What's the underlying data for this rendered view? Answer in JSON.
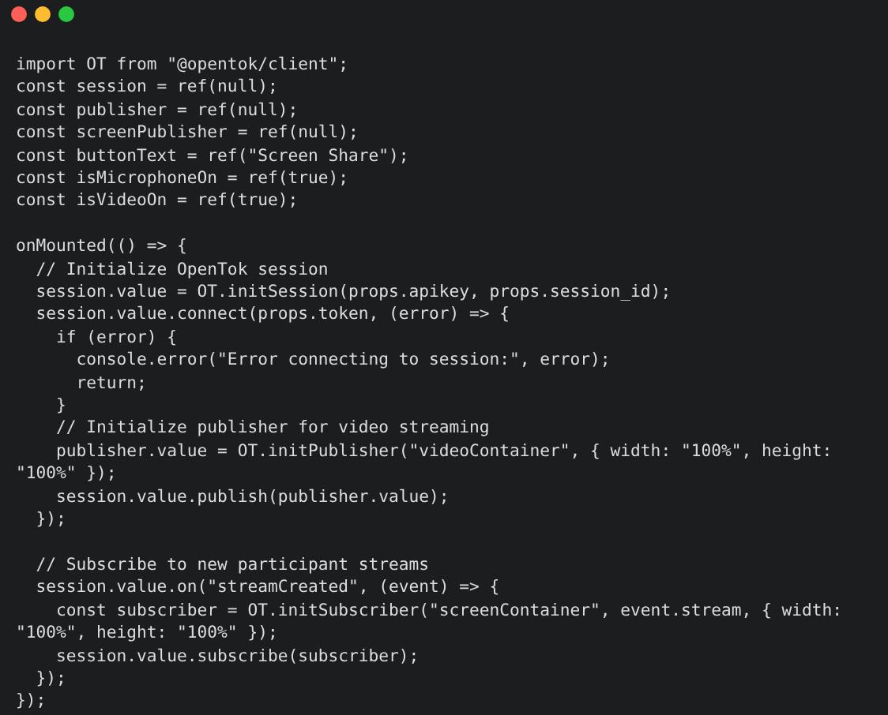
{
  "window_controls": [
    {
      "color": "#ff5f57"
    },
    {
      "color": "#febc2e"
    },
    {
      "color": "#28c840"
    }
  ],
  "code_lines": [
    {
      "text": "import OT from \"@opentok/client\";"
    },
    {
      "text": "const session = ref(null);"
    },
    {
      "text": "const publisher = ref(null);"
    },
    {
      "text": "const screenPublisher = ref(null);"
    },
    {
      "text": "const buttonText = ref(\"Screen Share\");"
    },
    {
      "text": "const isMicrophoneOn = ref(true);"
    },
    {
      "text": "const isVideoOn = ref(true);"
    },
    {
      "text": "onMounted(() => {",
      "gap_before": true
    },
    {
      "text": "  // Initialize OpenTok session"
    },
    {
      "text": "  session.value = OT.initSession(props.apikey, props.session_id);"
    },
    {
      "text": "  session.value.connect(props.token, (error) => {"
    },
    {
      "text": "    if (error) {"
    },
    {
      "text": "      console.error(\"Error connecting to session:\", error);"
    },
    {
      "text": "      return;"
    },
    {
      "text": "    }"
    },
    {
      "text": "    // Initialize publisher for video streaming"
    },
    {
      "text": "    publisher.value = OT.initPublisher(\"videoContainer\", { width: \"100%\", height:"
    },
    {
      "text": "\"100%\" });"
    },
    {
      "text": "    session.value.publish(publisher.value);"
    },
    {
      "text": "  });"
    },
    {
      "text": "  // Subscribe to new participant streams",
      "gap_before": true
    },
    {
      "text": "  session.value.on(\"streamCreated\", (event) => {"
    },
    {
      "text": "    const subscriber = OT.initSubscriber(\"screenContainer\", event.stream, { width:"
    },
    {
      "text": "\"100%\", height: \"100%\" });"
    },
    {
      "text": "    session.value.subscribe(subscriber);"
    },
    {
      "text": "  });"
    },
    {
      "text": "});"
    }
  ]
}
